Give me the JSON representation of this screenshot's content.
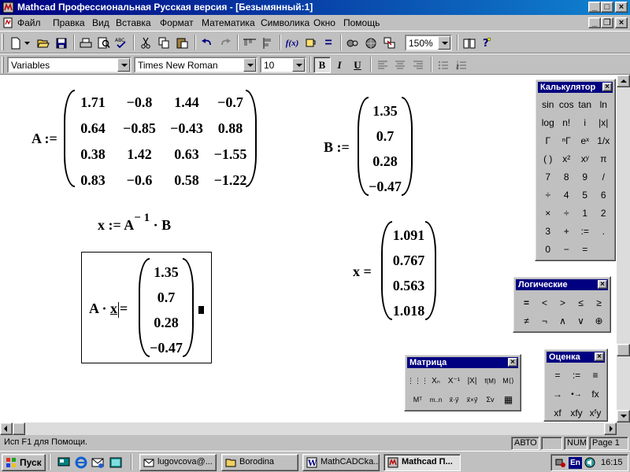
{
  "window": {
    "title": "Mathcad Профессиональная Русская версия - [Безымянный:1]",
    "minimize": "_",
    "maximize": "□",
    "close": "×",
    "child_restore": "❐"
  },
  "menu": [
    "Файл",
    "Правка",
    "Вид",
    "Вставка",
    "Формат",
    "Математика",
    "Символика",
    "Окно",
    "Помощь"
  ],
  "toolbar": {
    "zoom": "150%",
    "style": "Variables",
    "font": "Times New Roman",
    "size": "10",
    "bold": "B",
    "italic": "I",
    "underline": "U",
    "fx": "f(x)",
    "equals": "="
  },
  "worksheet": {
    "matrix_a_label": "A :=",
    "matrix_a": [
      [
        "1.71",
        "−0.8",
        "1.44",
        "−0.7"
      ],
      [
        "0.64",
        "−0.85",
        "−0.43",
        "0.88"
      ],
      [
        "0.38",
        "1.42",
        "0.63",
        "−1.55"
      ],
      [
        "0.83",
        "−0.6",
        "0.58",
        "−1.22"
      ]
    ],
    "vector_b_label": "B :=",
    "vector_b": [
      "1.35",
      "0.7",
      "0.28",
      "−0.47"
    ],
    "solve_lhs": "x := A",
    "solve_exp": "− 1",
    "solve_rhs": "· B",
    "result_label": "x =",
    "result": [
      "1.091",
      "0.767",
      "0.563",
      "1.018"
    ],
    "check_lhs": "A ·",
    "check_var": "x",
    "check_eq": "=",
    "check_result": [
      "1.35",
      "0.7",
      "0.28",
      "−0.47"
    ]
  },
  "palettes": {
    "calculator": {
      "title": "Калькулятор",
      "rows": [
        [
          "sin",
          "cos",
          "tan",
          "ln"
        ],
        [
          "log",
          "n!",
          "i",
          "|x|"
        ],
        [
          "Γ",
          "ⁿΓ",
          "eˣ",
          "1/x"
        ],
        [
          "( )",
          "x²",
          "xʸ",
          "π"
        ],
        [
          "7",
          "8",
          "9",
          "/"
        ],
        [
          "÷",
          "4",
          "5",
          "6"
        ],
        [
          "×",
          "÷",
          "1",
          "2"
        ],
        [
          "3",
          "+",
          ":=",
          "."
        ],
        [
          "0",
          "−",
          "=",
          ""
        ]
      ]
    },
    "boolean": {
      "title": "Логические",
      "rows": [
        [
          "=",
          "<",
          ">",
          "≤",
          "≥"
        ],
        [
          "≠",
          "¬",
          "∧",
          "∨",
          "⊕"
        ]
      ]
    },
    "matrix": {
      "title": "Матрица",
      "rows": [
        [
          "⋮⋮⋮",
          "Xₙ",
          "X⁻¹",
          "|X|",
          "f(M)",
          "M⟨⟩"
        ],
        [
          "Mᵀ",
          "m..n",
          "x⃗·y⃗",
          "x⃗×y⃗",
          "Σv",
          "▦"
        ]
      ]
    },
    "evaluation": {
      "title": "Оценка",
      "rows": [
        [
          "=",
          ":=",
          "≡"
        ],
        [
          "→",
          "•→",
          "fx"
        ],
        [
          "xf",
          "xfy",
          "xᶠy"
        ]
      ]
    }
  },
  "status": {
    "help": "Исп F1 для Помощи.",
    "auto": "АВТО",
    "num": "NUM",
    "page": "Page 1"
  },
  "taskbar": {
    "start": "Пуск",
    "tasks": [
      "lugovcova@...",
      "Borodina",
      "MathCADCka...",
      "Mathcad П..."
    ],
    "lang": "En",
    "clock": "16:15"
  }
}
